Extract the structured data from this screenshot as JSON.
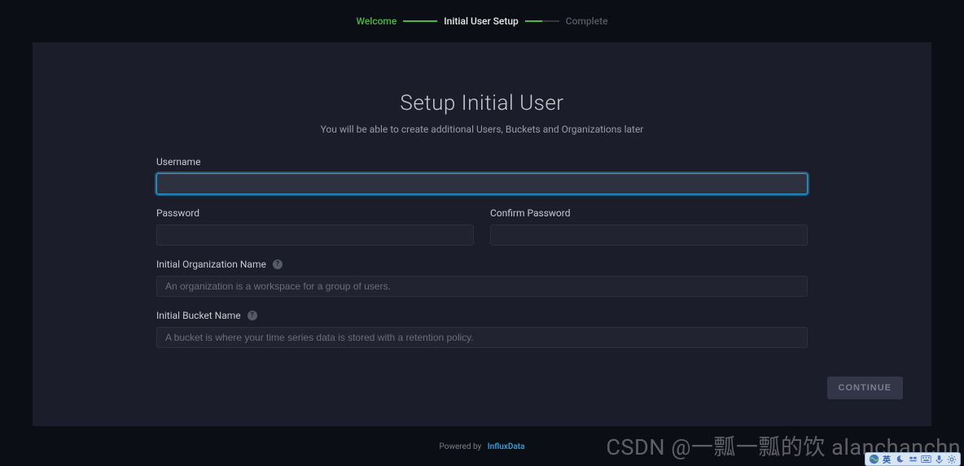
{
  "steps": {
    "welcome": "Welcome",
    "setup": "Initial User Setup",
    "complete": "Complete"
  },
  "header": {
    "title": "Setup Initial User",
    "subtitle": "You will be able to create additional Users, Buckets and Organizations later"
  },
  "form": {
    "username_label": "Username",
    "username_value": "",
    "password_label": "Password",
    "password_value": "",
    "confirm_label": "Confirm Password",
    "confirm_value": "",
    "org_label": "Initial Organization Name",
    "org_placeholder": "An organization is a workspace for a group of users.",
    "org_value": "",
    "bucket_label": "Initial Bucket Name",
    "bucket_placeholder": "A bucket is where your time series data is stored with a retention policy.",
    "bucket_value": ""
  },
  "buttons": {
    "continue": "CONTINUE"
  },
  "footer": {
    "powered": "Powered by",
    "brand": "InfluxData"
  },
  "watermark": "CSDN @一瓢一瓢的饮 alanchanchn",
  "tray": {
    "lang": "英"
  }
}
